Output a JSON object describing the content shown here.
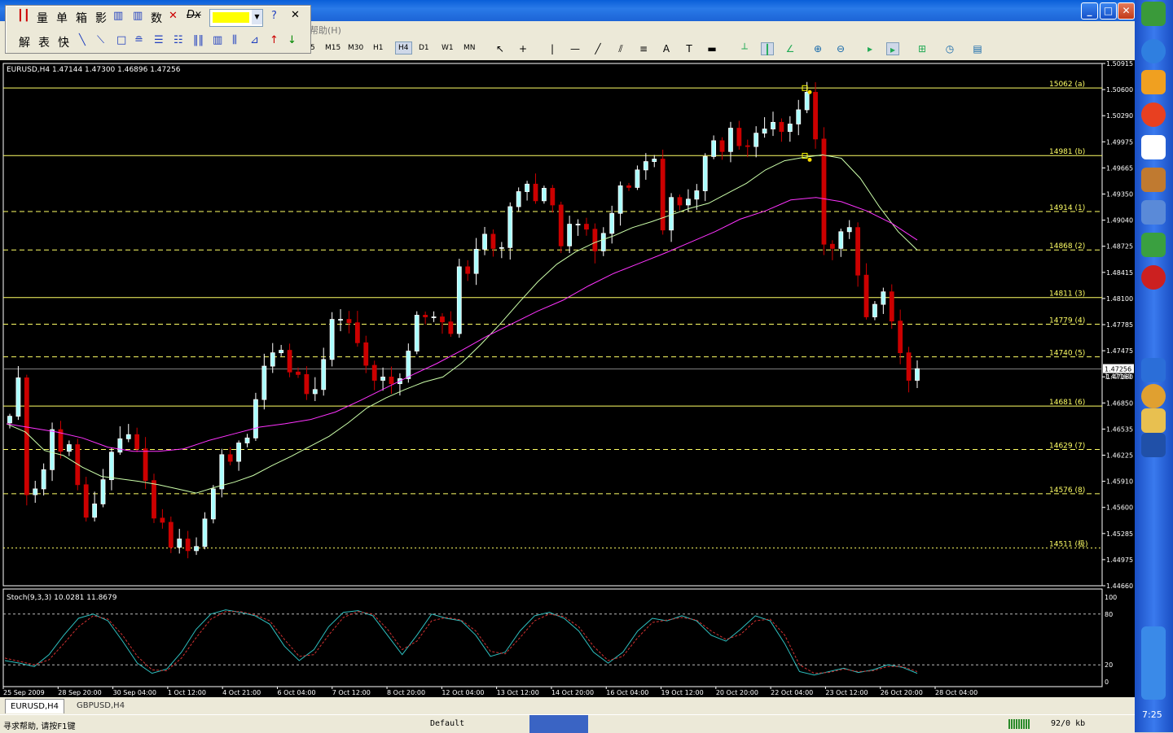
{
  "window": {
    "minimize": "_",
    "maximize": "□",
    "close": "✕"
  },
  "menu": {
    "help_label": "帮助(H)"
  },
  "floating_toolbar": {
    "row1": [
      "量",
      "单",
      "箱",
      "影",
      "数"
    ],
    "row2": [
      "解",
      "表",
      "快"
    ],
    "dx_label": "Dx",
    "color": "#ffff00"
  },
  "timeframes": [
    "M5",
    "M15",
    "M30",
    "H1",
    "H4",
    "D1",
    "W1",
    "MN"
  ],
  "timeframe_partial": "5",
  "timeframe_active": "H4",
  "chart_data": [
    {
      "type": "candlestick",
      "title": "EURUSD,H4  1.47144 1.47300 1.46896 1.47256",
      "symbol": "EURUSD",
      "period": "H4",
      "ohlc_readout": {
        "open": 1.47144,
        "high": 1.473,
        "low": 1.46896,
        "close": 1.47256
      },
      "current_price": "1.47256",
      "y_right_label_extra": "1.47160",
      "y_axis": {
        "ticks": [
          "1.50915",
          "1.50600",
          "1.50290",
          "1.49975",
          "1.49665",
          "1.49350",
          "1.49040",
          "1.48725",
          "1.48415",
          "1.48100",
          "1.47785",
          "1.47475",
          "1.47160",
          "1.46850",
          "1.46535",
          "1.46225",
          "1.45910",
          "1.45600",
          "1.45285",
          "1.44975",
          "1.44660"
        ],
        "range": [
          1.4466,
          1.50915
        ]
      },
      "x_axis": {
        "ticks": [
          "25 Sep 2009",
          "28 Sep 20:00",
          "30 Sep 04:00",
          "1 Oct 12:00",
          "4 Oct 21:00",
          "6 Oct 04:00",
          "7 Oct 12:00",
          "8 Oct 20:00",
          "12 Oct 04:00",
          "13 Oct 12:00",
          "14 Oct 20:00",
          "16 Oct 04:00",
          "19 Oct 12:00",
          "20 Oct 20:00",
          "22 Oct 04:00",
          "23 Oct 12:00",
          "26 Oct 20:00",
          "28 Oct 04:00"
        ]
      },
      "colors": {
        "bull": "#ffffff",
        "bear": "#cc0000",
        "bull_body": "#aaffff",
        "ma_fast": "#ccffaa",
        "ma_slow": "#ff33ff",
        "levels": "#ffff66"
      },
      "levels": [
        {
          "label": "15062 (a)",
          "price": 1.50622,
          "style": "solid"
        },
        {
          "label": "14981 (b)",
          "price": 1.49812,
          "style": "solid"
        },
        {
          "label": "14914 (1)",
          "price": 1.49142,
          "style": "dashed"
        },
        {
          "label": "14868 (2)",
          "price": 1.48682,
          "style": "dashed"
        },
        {
          "label": "14811 (3)",
          "price": 1.48112,
          "style": "solid"
        },
        {
          "label": "14779 (4)",
          "price": 1.47792,
          "style": "dashed"
        },
        {
          "label": "14740 (5)",
          "price": 1.47402,
          "style": "dashed"
        },
        {
          "label": "14681 (6)",
          "price": 1.46812,
          "style": "solid"
        },
        {
          "label": "14629 (7)",
          "price": 1.46292,
          "style": "dashed"
        },
        {
          "label": "14576 (8)",
          "price": 1.45762,
          "style": "dashed"
        },
        {
          "label": "14511 (极)",
          "price": 1.45112,
          "style": "dotted"
        }
      ],
      "closes": [
        1.4669,
        1.4715,
        1.4575,
        1.4582,
        1.4605,
        1.4653,
        1.4627,
        1.4635,
        1.4587,
        1.4548,
        1.4564,
        1.4593,
        1.4626,
        1.4642,
        1.4647,
        1.463,
        1.4592,
        1.4547,
        1.4542,
        1.4512,
        1.4522,
        1.4508,
        1.4513,
        1.4546,
        1.4582,
        1.4623,
        1.4615,
        1.4637,
        1.4643,
        1.4689,
        1.4729,
        1.4745,
        1.4748,
        1.4722,
        1.4719,
        1.4696,
        1.4701,
        1.4737,
        1.4785,
        1.4785,
        1.4781,
        1.4757,
        1.473,
        1.4712,
        1.4716,
        1.4708,
        1.4714,
        1.4747,
        1.479,
        1.4788,
        1.4788,
        1.4782,
        1.4768,
        1.4848,
        1.484,
        1.4869,
        1.4887,
        1.487,
        1.4871,
        1.492,
        1.4938,
        1.4947,
        1.4927,
        1.4942,
        1.4922,
        1.4873,
        1.4899,
        1.4899,
        1.4893,
        1.4867,
        1.4888,
        1.4912,
        1.4945,
        1.4943,
        1.4964,
        1.4974,
        1.4977,
        1.4892,
        1.4931,
        1.4922,
        1.4929,
        1.4939,
        1.498,
        1.4999,
        1.4986,
        1.5014,
        1.4993,
        1.4992,
        1.5008,
        1.5013,
        1.5021,
        1.501,
        1.5019,
        1.5036,
        1.5057,
        1.5001,
        1.4875,
        1.487,
        1.489,
        1.4895,
        1.4838,
        1.4788,
        1.4803,
        1.4818,
        1.4783,
        1.4745,
        1.4712,
        1.4726
      ],
      "ma_fast": [
        1.466,
        1.465,
        1.4628,
        1.4622,
        1.4608,
        1.4597,
        1.4594,
        1.4591,
        1.4587,
        1.4582,
        1.4577,
        1.4584,
        1.459,
        1.4598,
        1.461,
        1.4621,
        1.4633,
        1.4645,
        1.4661,
        1.4679,
        1.4691,
        1.4701,
        1.471,
        1.4716,
        1.4733,
        1.4755,
        1.4779,
        1.4805,
        1.483,
        1.4851,
        1.4866,
        1.4877,
        1.4885,
        1.4895,
        1.4902,
        1.491,
        1.4918,
        1.4924,
        1.4936,
        1.4948,
        1.4964,
        1.4975,
        1.4979,
        1.4982,
        1.4978,
        1.4954,
        1.492,
        1.489,
        1.4868
      ],
      "ma_slow": [
        1.466,
        1.4655,
        1.465,
        1.4643,
        1.4632,
        1.4627,
        1.4627,
        1.463,
        1.464,
        1.4648,
        1.4656,
        1.466,
        1.4665,
        1.4674,
        1.4688,
        1.4703,
        1.4718,
        1.4732,
        1.4748,
        1.4765,
        1.478,
        1.4795,
        1.4808,
        1.4825,
        1.484,
        1.4852,
        1.4864,
        1.4877,
        1.489,
        1.4905,
        1.4915,
        1.4928,
        1.4931,
        1.4926,
        1.4915,
        1.49,
        1.488
      ]
    },
    {
      "type": "line",
      "title": "Stoch(9,3,3) 10.0281 11.8679",
      "y_axis": {
        "ticks": [
          "100",
          "80",
          "20",
          "0"
        ],
        "range": [
          0,
          100
        ]
      },
      "reference_levels": [
        80,
        20
      ],
      "series": [
        {
          "color": "#2ec0c0",
          "values": [
            25,
            22,
            18,
            32,
            55,
            75,
            80,
            72,
            48,
            22,
            10,
            15,
            35,
            62,
            80,
            85,
            82,
            78,
            68,
            42,
            25,
            38,
            65,
            82,
            84,
            78,
            55,
            32,
            55,
            80,
            75,
            72,
            55,
            30,
            35,
            60,
            78,
            82,
            75,
            60,
            35,
            22,
            35,
            60,
            75,
            72,
            78,
            72,
            55,
            48,
            62,
            78,
            72,
            45,
            12,
            8,
            12,
            16,
            11,
            14,
            20,
            17,
            10
          ]
        },
        {
          "color": "#d03030",
          "values": [
            28,
            24,
            20,
            26,
            45,
            65,
            78,
            74,
            55,
            30,
            14,
            13,
            28,
            52,
            74,
            83,
            83,
            79,
            72,
            50,
            30,
            32,
            55,
            76,
            83,
            80,
            62,
            38,
            48,
            72,
            76,
            73,
            60,
            36,
            33,
            52,
            72,
            80,
            77,
            65,
            42,
            25,
            30,
            52,
            70,
            73,
            76,
            73,
            60,
            50,
            56,
            72,
            74,
            55,
            20,
            10,
            11,
            15,
            12,
            13,
            18,
            18,
            12
          ]
        }
      ]
    }
  ],
  "tabs": [
    "EURUSD,H4",
    "GBPUSD,H4"
  ],
  "status": {
    "help": "寻求帮助, 请按F1键",
    "profile": "Default",
    "traffic": "92/0 kb"
  },
  "clock": "7:25"
}
